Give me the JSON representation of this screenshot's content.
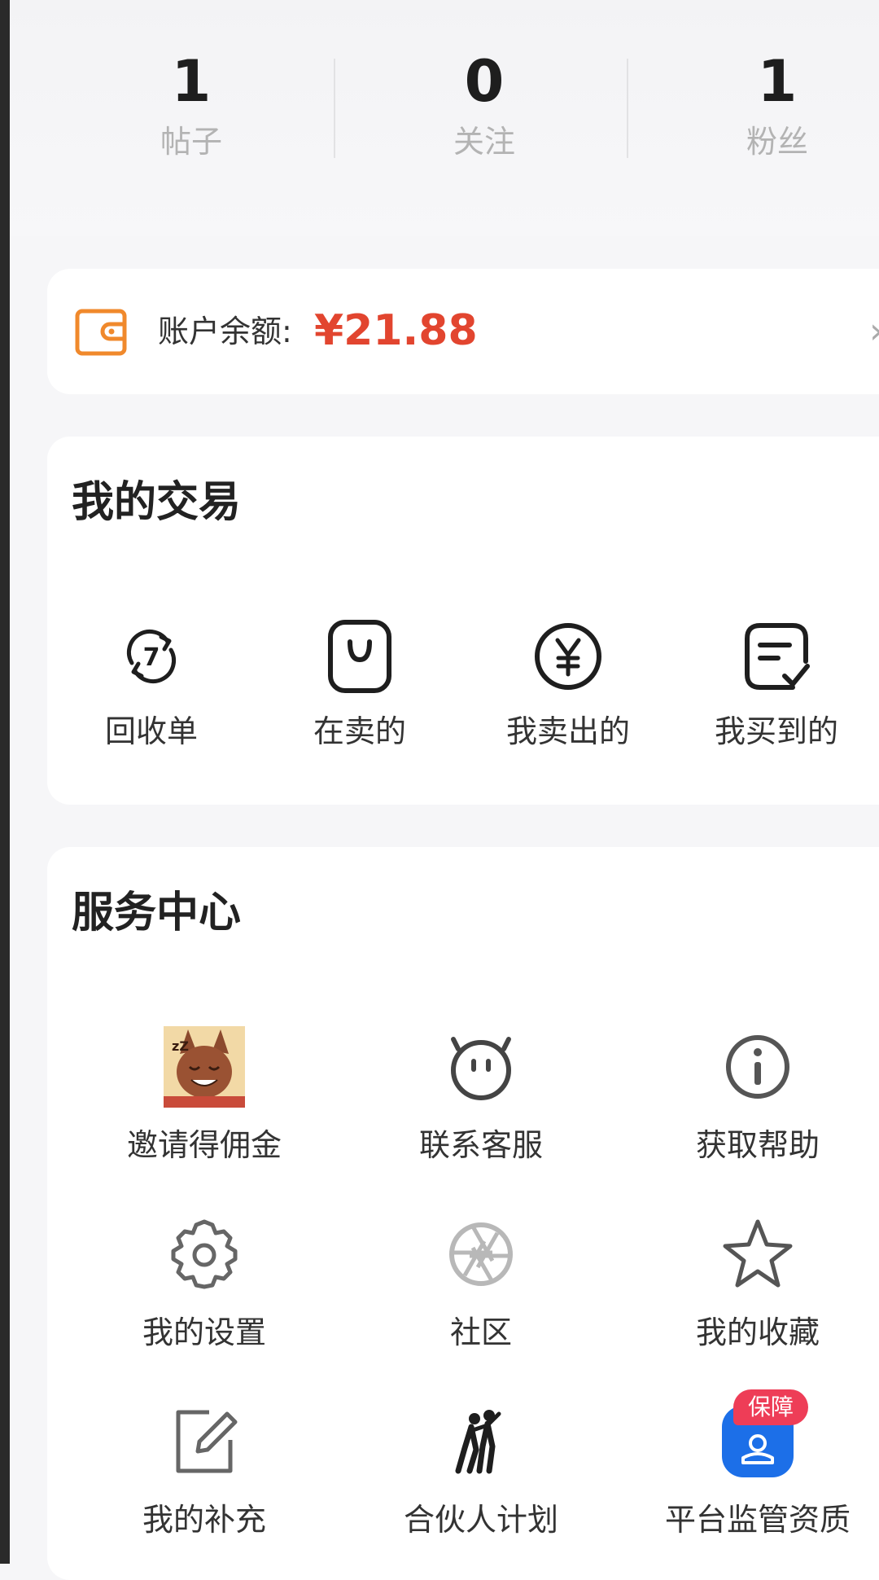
{
  "stats": [
    {
      "value": "1",
      "label": "帖子"
    },
    {
      "value": "0",
      "label": "关注"
    },
    {
      "value": "1",
      "label": "粉丝"
    }
  ],
  "balance": {
    "label": "账户余额:",
    "value": "¥21.88",
    "icon": "wallet-icon",
    "arrow_icon": "chevron-right-icon"
  },
  "trade": {
    "title": "我的交易",
    "items": [
      {
        "label": "回收单",
        "icon": "recycle-7-icon"
      },
      {
        "label": "在卖的",
        "icon": "shopping-bag-icon"
      },
      {
        "label": "我卖出的",
        "icon": "yen-coin-icon"
      },
      {
        "label": "我买到的",
        "icon": "checked-note-icon"
      }
    ]
  },
  "services": {
    "title": "服务中心",
    "items": [
      {
        "label": "邀请得佣金",
        "icon": "cartoon-avatar-icon"
      },
      {
        "label": "联系客服",
        "icon": "robot-face-icon"
      },
      {
        "label": "获取帮助",
        "icon": "info-icon"
      },
      {
        "label": "我的设置",
        "icon": "gear-icon"
      },
      {
        "label": "社区",
        "icon": "aperture-icon"
      },
      {
        "label": "我的收藏",
        "icon": "star-icon"
      },
      {
        "label": "我的补充",
        "icon": "edit-icon"
      },
      {
        "label": "合伙人计划",
        "icon": "partners-icon"
      },
      {
        "label": "平台监管资质",
        "icon": "shield-user-icon",
        "badge": "保障"
      }
    ]
  },
  "colors": {
    "accent_red": "#e2452f",
    "wallet_orange": "#f0892c",
    "badge_pink": "#ee3d57",
    "blue": "#1c6fe8"
  }
}
